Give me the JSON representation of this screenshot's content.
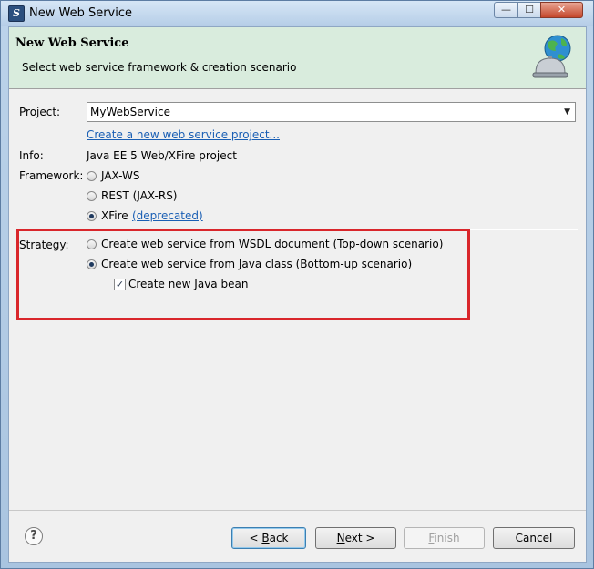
{
  "window": {
    "title": "New Web Service",
    "close_glyph": "✕",
    "minimize_glyph": "—",
    "maximize_glyph": "☐"
  },
  "banner": {
    "title": "New Web Service",
    "subtitle": "Select web service framework & creation scenario",
    "icon": "globe-bell-icon"
  },
  "form": {
    "project_label": "Project:",
    "project_value": "MyWebService",
    "create_project_link": "Create a new web service project...",
    "info_label": "Info:",
    "info_value": "Java EE 5 Web/XFire project",
    "framework_label": "Framework:",
    "framework_options": [
      {
        "label": "JAX-WS",
        "selected": false
      },
      {
        "label": "REST (JAX-RS)",
        "selected": false
      },
      {
        "label": "XFire",
        "selected": true
      }
    ],
    "deprecated_link": "(deprecated)",
    "strategy_label": "Strategy:",
    "strategy_options": [
      {
        "label": "Create web service from WSDL document (Top-down scenario)",
        "selected": false
      },
      {
        "label": "Create web service from Java class (Bottom-up scenario)",
        "selected": true
      }
    ],
    "create_bean_label": "Create new Java bean",
    "create_bean_checked": true,
    "highlight_color": "#d9262b"
  },
  "buttons": {
    "help": "?",
    "back_prefix": "< ",
    "back_mnemonic": "B",
    "back_rest": "ack",
    "next_mnemonic": "N",
    "next_rest": "ext >",
    "finish_mnemonic": "F",
    "finish_rest": "inish",
    "cancel": "Cancel"
  }
}
